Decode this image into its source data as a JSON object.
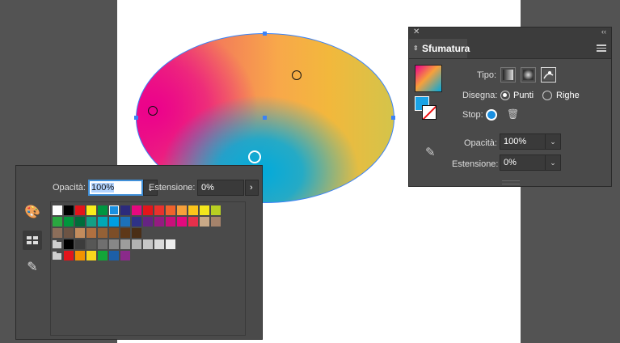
{
  "gradient_panel": {
    "title": "Sfumatura",
    "tipo_label": "Tipo:",
    "disegna_label": "Disegna:",
    "punti_label": "Punti",
    "righe_label": "Righe",
    "stop_label": "Stop:",
    "opacita_label": "Opacità:",
    "opacita_value": "100%",
    "estensione_label": "Estensione:",
    "estensione_value": "0%",
    "close_glyph": "✕",
    "collapse_glyph": "‹‹",
    "stop_color": "#1a8fe0"
  },
  "swatch_panel": {
    "opacita_label": "Opacità:",
    "opacita_value": "100%",
    "estensione_label": "Estensione:",
    "estensione_value": "0%",
    "arrow_glyph": "›",
    "row1": [
      "#ffffff",
      "#000000",
      "#e3151b",
      "#f9ec1b",
      "#009640",
      "#1a8fe0",
      "#2c2a7c",
      "#e5097f",
      "#e3151b",
      "#e9322d",
      "#f0622b",
      "#f7a03a",
      "#fcc51b",
      "#f3e61c",
      "#b8cf22"
    ],
    "row1_selected_index": 5,
    "row2": [
      "#2aa840",
      "#00963c",
      "#006c3a",
      "#13a085",
      "#00a8b5",
      "#009ee3",
      "#1d71b8",
      "#2e3287",
      "#662483",
      "#951b81",
      "#c8107a",
      "#e4097e",
      "#e7304b",
      "#c9a987",
      "#a5836b"
    ],
    "row3": [
      "#8c6e5a",
      "#6d5444",
      "#c38c5d",
      "#b07040",
      "#946136",
      "#7d4e28",
      "#5e3818",
      "#4a2e16"
    ],
    "row4": [
      "#000000",
      "#3c3c3c",
      "#575756",
      "#706f6f",
      "#878787",
      "#9d9d9c",
      "#b2b2b2",
      "#c6c6c6",
      "#dadada",
      "#ededed"
    ],
    "row5": [
      "#e3151b",
      "#f39200",
      "#f9d71c",
      "#13a538",
      "#1d5fa8",
      "#8a2a8b"
    ],
    "icons": [
      "palette-icon",
      "swatches-icon",
      "eyedropper-icon"
    ]
  }
}
